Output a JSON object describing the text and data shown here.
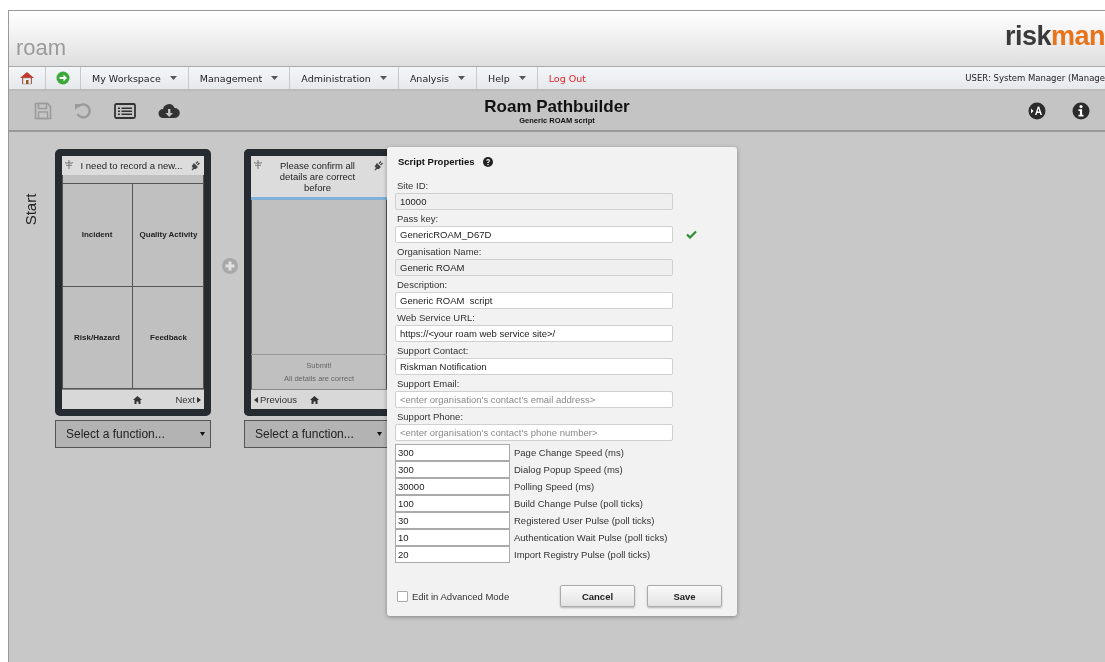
{
  "header": {
    "app_name": "roam",
    "logo": {
      "dark": "risk",
      "accent": "man"
    }
  },
  "nav": {
    "items": [
      {
        "kind": "home"
      },
      {
        "kind": "go"
      },
      {
        "kind": "menu",
        "label": "My Workspace"
      },
      {
        "kind": "menu",
        "label": "Management"
      },
      {
        "kind": "menu",
        "label": "Administration"
      },
      {
        "kind": "menu",
        "label": "Analysis"
      },
      {
        "kind": "menu",
        "label": "Help"
      },
      {
        "kind": "logout",
        "label": "Log Out"
      }
    ],
    "user": "USER: System Manager (Manage"
  },
  "toolbar": {
    "title": "Roam Pathbuilder",
    "subtitle": "Generic ROAM script",
    "save_disabled": true,
    "undo_disabled": true
  },
  "canvas": {
    "start_label": "Start",
    "cards": [
      {
        "kind": "menu",
        "header": "I need to record a new...",
        "tiles": [
          "Incident",
          "Quality Activity",
          "Risk/Hazard",
          "Feedback"
        ],
        "next": "Next",
        "select": "Select a function..."
      },
      {
        "kind": "confirm",
        "header": "Please confirm all details are correct before",
        "submit": "Submit!",
        "submit_note": "All details are correct",
        "previous": "Previous",
        "select": "Select a function..."
      }
    ]
  },
  "dialog": {
    "title": "Script Properties",
    "fields": [
      {
        "label": "Site ID:",
        "value": "10000",
        "disabled": true,
        "valid": false
      },
      {
        "label": "Pass key:",
        "value": "GenericROAM_D67D",
        "disabled": false,
        "valid": true
      },
      {
        "label": "Organisation Name:",
        "value": "Generic ROAM",
        "disabled": true,
        "valid": false
      },
      {
        "label": "Description:",
        "value": "Generic ROAM  script",
        "disabled": false,
        "valid": false
      },
      {
        "label": "Web Service URL:",
        "value": "https://<your roam web service site>/",
        "disabled": false,
        "valid": false
      },
      {
        "label": "Support Contact:",
        "value": "Riskman Notification",
        "disabled": false,
        "valid": false
      },
      {
        "label": "Support Email:",
        "placeholder": "<enter organisation's contact's email address>",
        "disabled": false,
        "valid": false
      },
      {
        "label": "Support Phone:",
        "placeholder": "<enter organisation's contact's phone number>",
        "disabled": false,
        "valid": false
      }
    ],
    "settings": [
      {
        "value": "300",
        "label": "Page Change Speed (ms)"
      },
      {
        "value": "300",
        "label": "Dialog Popup Speed (ms)"
      },
      {
        "value": "30000",
        "label": "Polling Speed (ms)"
      },
      {
        "value": "100",
        "label": "Build Change Pulse (poll ticks)"
      },
      {
        "value": "30",
        "label": "Registered User Pulse (poll ticks)"
      },
      {
        "value": "10",
        "label": "Authentication Wait Pulse (poll ticks)"
      },
      {
        "value": "20",
        "label": "Import Registry Pulse (poll ticks)"
      }
    ],
    "advanced_mode": {
      "label": "Edit in Advanced Mode",
      "checked": false
    },
    "buttons": [
      "Cancel",
      "Save"
    ]
  }
}
